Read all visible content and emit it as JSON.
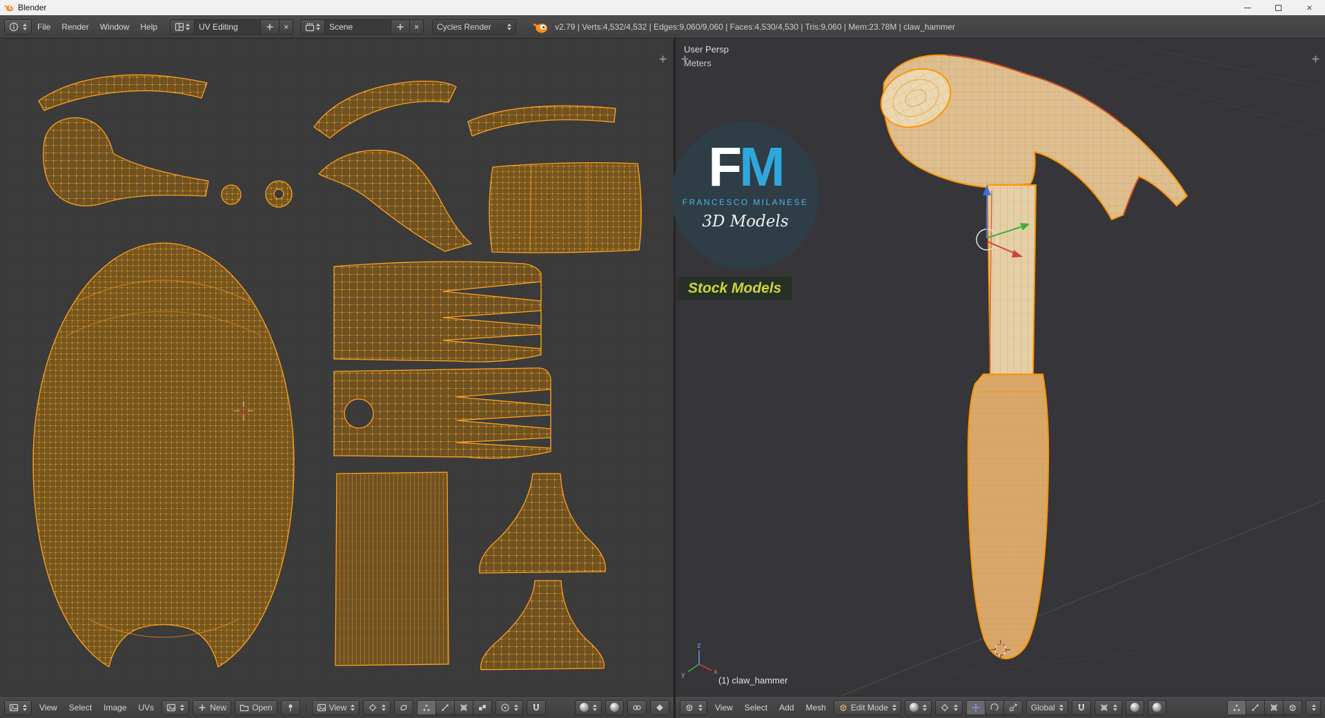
{
  "colors": {
    "accent_orange": "#ff9a1f",
    "uv_island_fill": "#6f5222",
    "seam_red": "#c8372d",
    "logo_blue": "#2fa7dc",
    "badge_green": "#ccd838",
    "viewport_bg": "#35353a",
    "uv_bg": "#3b3b3b"
  },
  "titlebar": {
    "title": "Blender",
    "close_glyph": "×"
  },
  "infobar": {
    "menus": [
      "File",
      "Render",
      "Window",
      "Help"
    ],
    "layout_value": "UV Editing",
    "scene_value": "Scene",
    "engine_value": "Cycles Render",
    "dismiss_glyph": "×",
    "stats": "v2.79 | Verts:4,532/4,532 | Edges:9,060/9,060 | Faces:4,530/4,530 | Tris:9,060 | Mem:23.78M | claw_hammer"
  },
  "viewport3d": {
    "view_name": "User Persp",
    "units": "Meters",
    "object_info": "(1) claw_hammer",
    "axis_x": "x",
    "axis_y": "y",
    "axis_z": "z"
  },
  "watermark": {
    "letter_f": "F",
    "letter_m": "M",
    "author": "FRANCESCO MILANESE",
    "subtitle": "3D Models",
    "badge": "Stock Models"
  },
  "uv_header": {
    "menus": [
      "View",
      "Select",
      "Image",
      "UVs"
    ],
    "new_label": "New",
    "open_label": "Open",
    "display_value": "View"
  },
  "view3d_header": {
    "menus": [
      "View",
      "Select",
      "Add",
      "Mesh"
    ],
    "mode_value": "Edit Mode",
    "orientation_value": "Global"
  },
  "icons": {
    "titlebar": [
      "blender-logo-icon",
      "minimize-icon",
      "maximize-icon",
      "close-icon"
    ],
    "infobar": [
      "info-editor-icon",
      "dropdown-arrows-icon",
      "layout-browse-icon",
      "add-icon",
      "dismiss-icon",
      "scene-browse-icon",
      "blender-logo-icon"
    ],
    "uv_header": [
      "image-editor-icon",
      "image-browse-icon",
      "new-image-icon",
      "open-folder-icon",
      "pin-icon",
      "display-mode-icon",
      "pivot-center-icon",
      "uv-sync-icon",
      "select-vertex-icon",
      "select-edge-icon",
      "select-face-icon",
      "select-island-icon",
      "proportional-edit-icon",
      "snap-magnet-icon",
      "snap-element-icon",
      "render-slot-icon",
      "link-icon",
      "keyframe-icon"
    ],
    "view3d_header": [
      "view3d-editor-icon",
      "mode-cube-icon",
      "viewport-shading-icon",
      "pivot-point-icon",
      "manipulator-translate-icon",
      "manipulator-rotate-icon",
      "manipulator-scale-icon",
      "snap-magnet-icon",
      "snap-element-icon",
      "opengl-render-icon",
      "opengl-anim-icon",
      "select-vertex-icon",
      "select-edge-icon",
      "select-face-icon",
      "occlude-icon",
      "header-collapse-icon"
    ]
  }
}
